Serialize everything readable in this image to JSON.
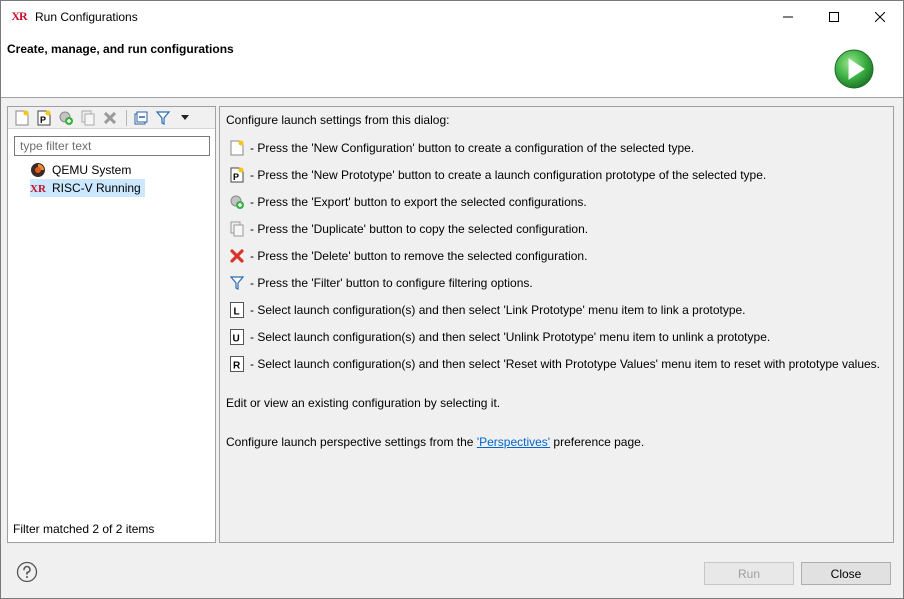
{
  "window": {
    "title": "Run Configurations",
    "app_icon_text": "XR"
  },
  "banner": {
    "title": "Create, manage, and run configurations",
    "icon": "run-play-icon"
  },
  "left": {
    "toolbar_icons": [
      "new-configuration-icon",
      "new-prototype-icon",
      "export-icon",
      "duplicate-icon",
      "delete-icon",
      "collapse-all-icon",
      "filter-icon",
      "dropdown-arrow-icon"
    ],
    "filter_placeholder": "type filter text",
    "filter_value": "",
    "tree": [
      {
        "label": "QEMU System",
        "icon": "qemu-icon",
        "selected": false
      },
      {
        "label": "RISC-V Running",
        "icon": "xr-icon",
        "selected": true
      }
    ],
    "status": "Filter matched 2 of 2 items"
  },
  "right": {
    "intro": "Configure launch settings from this dialog:",
    "instructions": [
      {
        "icon": "new-configuration-icon",
        "text": "- Press the 'New Configuration' button to create a configuration of the selected type."
      },
      {
        "icon": "new-prototype-icon",
        "text": "- Press the 'New Prototype' button to create a launch configuration prototype of the selected type."
      },
      {
        "icon": "export-icon",
        "text": "- Press the 'Export' button to export the selected configurations."
      },
      {
        "icon": "duplicate-icon",
        "text": "- Press the 'Duplicate' button to copy the selected configuration."
      },
      {
        "icon": "delete-icon",
        "text": "- Press the 'Delete' button to remove the selected configuration."
      },
      {
        "icon": "filter-icon",
        "text": "- Press the 'Filter' button to configure filtering options."
      },
      {
        "icon": "link-prototype-icon",
        "text": "- Select launch configuration(s) and then select 'Link Prototype' menu item to link a prototype."
      },
      {
        "icon": "unlink-prototype-icon",
        "text": "- Select launch configuration(s) and then select 'Unlink Prototype' menu item to unlink a prototype."
      },
      {
        "icon": "reset-prototype-icon",
        "text": "- Select launch configuration(s) and then select 'Reset with Prototype Values' menu item to reset with prototype values."
      }
    ],
    "edit_text": "Edit or view an existing configuration by selecting it.",
    "perspectives_prefix": "Configure launch perspective settings from the ",
    "perspectives_link": "'Perspectives'",
    "perspectives_suffix": " preference page."
  },
  "buttons": {
    "run": "Run",
    "close": "Close",
    "run_enabled": false
  },
  "colors": {
    "accent_link": "#0066cc",
    "selection": "#cce8ff",
    "run_green": "#3cb043",
    "delete_red": "#d9332a",
    "app_red": "#c8102e"
  }
}
